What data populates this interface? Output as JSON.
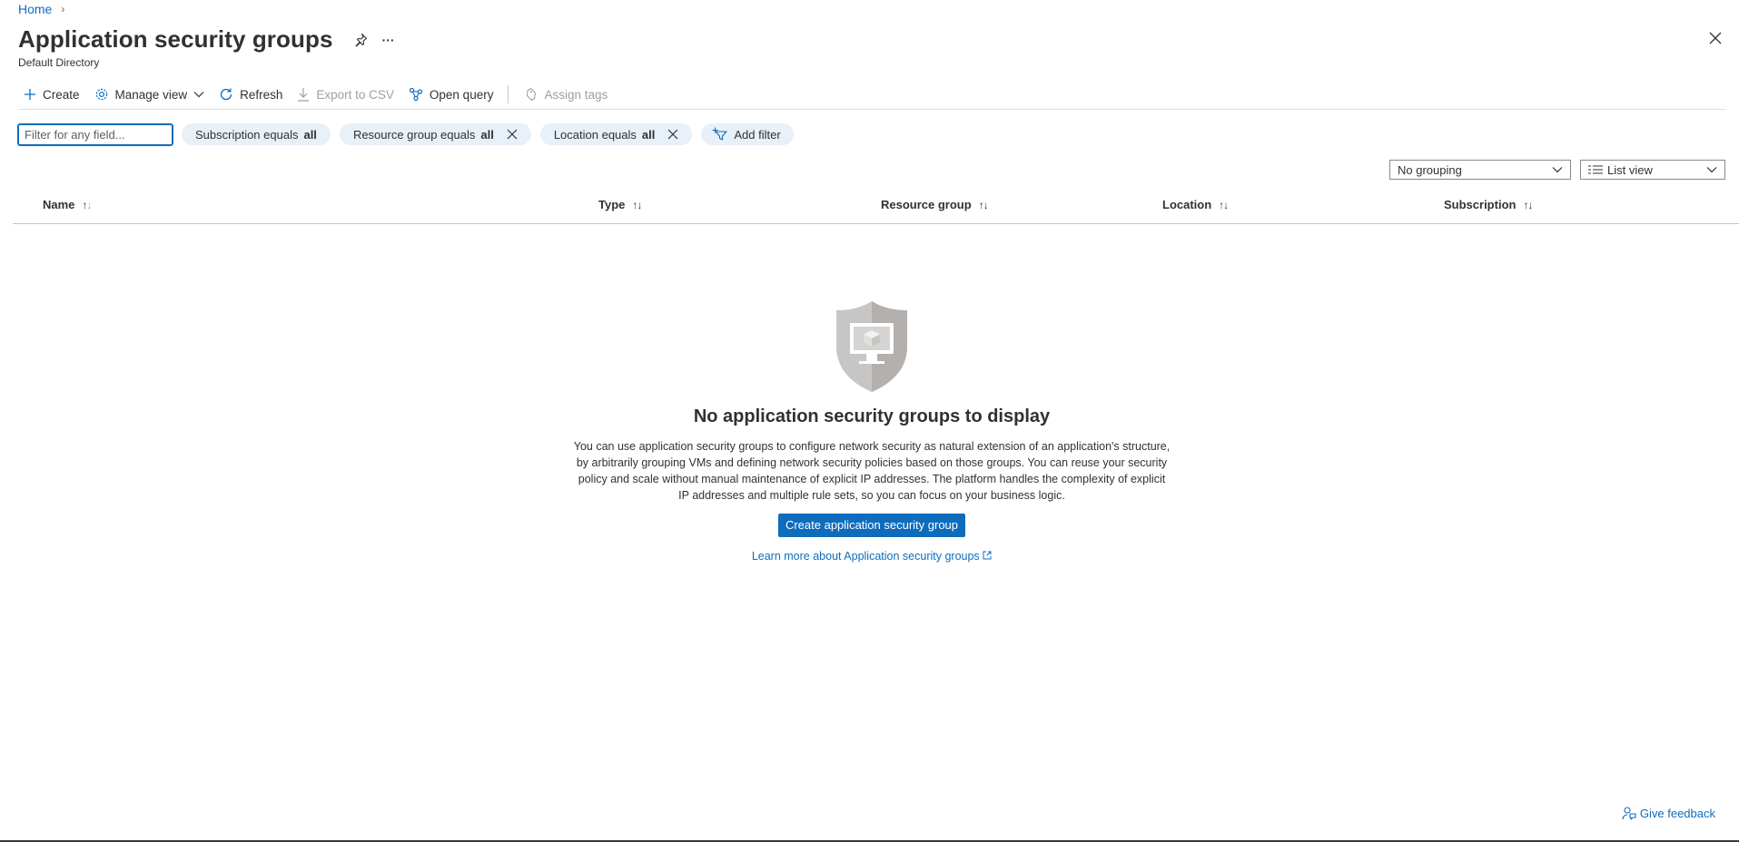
{
  "breadcrumb": {
    "home": "Home",
    "separator": "›"
  },
  "header": {
    "title": "Application security groups",
    "subtitle": "Default Directory",
    "more": "···"
  },
  "toolbar": {
    "create": "Create",
    "manage_view": "Manage view",
    "refresh": "Refresh",
    "export_csv": "Export to CSV",
    "open_query": "Open query",
    "assign_tags": "Assign tags"
  },
  "filters": {
    "placeholder": "Filter for any field...",
    "subscription_label": "Subscription equals",
    "subscription_value": "all",
    "resource_group_label": "Resource group equals",
    "resource_group_value": "all",
    "location_label": "Location equals",
    "location_value": "all",
    "add_filter": "Add filter"
  },
  "view": {
    "grouping": "No grouping",
    "list_view": "List view"
  },
  "table": {
    "columns": [
      "Name",
      "Type",
      "Resource group",
      "Location",
      "Subscription"
    ]
  },
  "empty_state": {
    "title": "No application security groups to display",
    "description": "You can use application security groups to configure network security as natural extension of an application's structure, by arbitrarily grouping VMs and defining network security policies based on those groups. You can reuse your security policy and scale without manual maintenance of explicit IP addresses. The platform handles the complexity of explicit IP addresses and multiple rule sets, so you can focus on your business logic.",
    "create_button": "Create application security group",
    "learn_more": "Learn more about Application security groups"
  },
  "feedback": "Give feedback",
  "colors": {
    "accent": "#0f6cbd",
    "pill_bg": "#e8f0f8",
    "text": "#323130"
  }
}
